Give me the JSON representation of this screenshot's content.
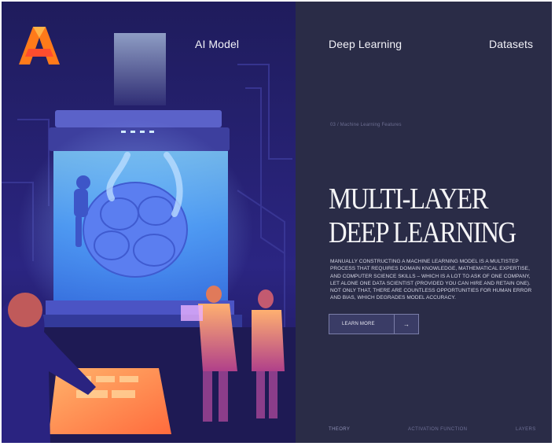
{
  "nav": {
    "items": [
      {
        "label": "AI Model"
      },
      {
        "label": "Deep Learning"
      },
      {
        "label": "Datasets"
      }
    ]
  },
  "logo": {
    "icon": "letter-a-logo-icon",
    "colors": [
      "#ff7a1a",
      "#ffb347",
      "#ff4d2e"
    ]
  },
  "hero": {
    "eyebrow": "03 / Machine Learning Features",
    "headline_line1": "MULTI-LAYER",
    "headline_line2": "DEEP LEARNING",
    "description": "MANUALLY CONSTRUCTING A MACHINE LEARNING MODEL IS A MULTISTEP PROCESS THAT REQUIRES DOMAIN KNOWLEDGE, MATHEMATICAL EXPERTISE, AND COMPUTER SCIENCE SKILLS – WHICH IS A LOT TO ASK OF ONE COMPANY, LET ALONE ONE DATA SCIENTIST (PROVIDED YOU CAN HIRE AND RETAIN ONE). NOT ONLY THAT, THERE ARE COUNTLESS OPPORTUNITIES FOR HUMAN ERROR AND BIAS, WHICH DEGRADES MODEL ACCURACY.",
    "cta_label": "LEARN MORE",
    "cta_icon": "arrow-right-icon"
  },
  "footer": {
    "items": [
      {
        "label": "THEORY"
      },
      {
        "label": "ACTIVATION FUNCTION"
      },
      {
        "label": "LAYERS"
      }
    ]
  },
  "colors": {
    "background": "#2a2c47",
    "illustration_base": "#24226a",
    "accent_glow": "#8fd0ff",
    "accent_orange": "#ff8a3d"
  }
}
